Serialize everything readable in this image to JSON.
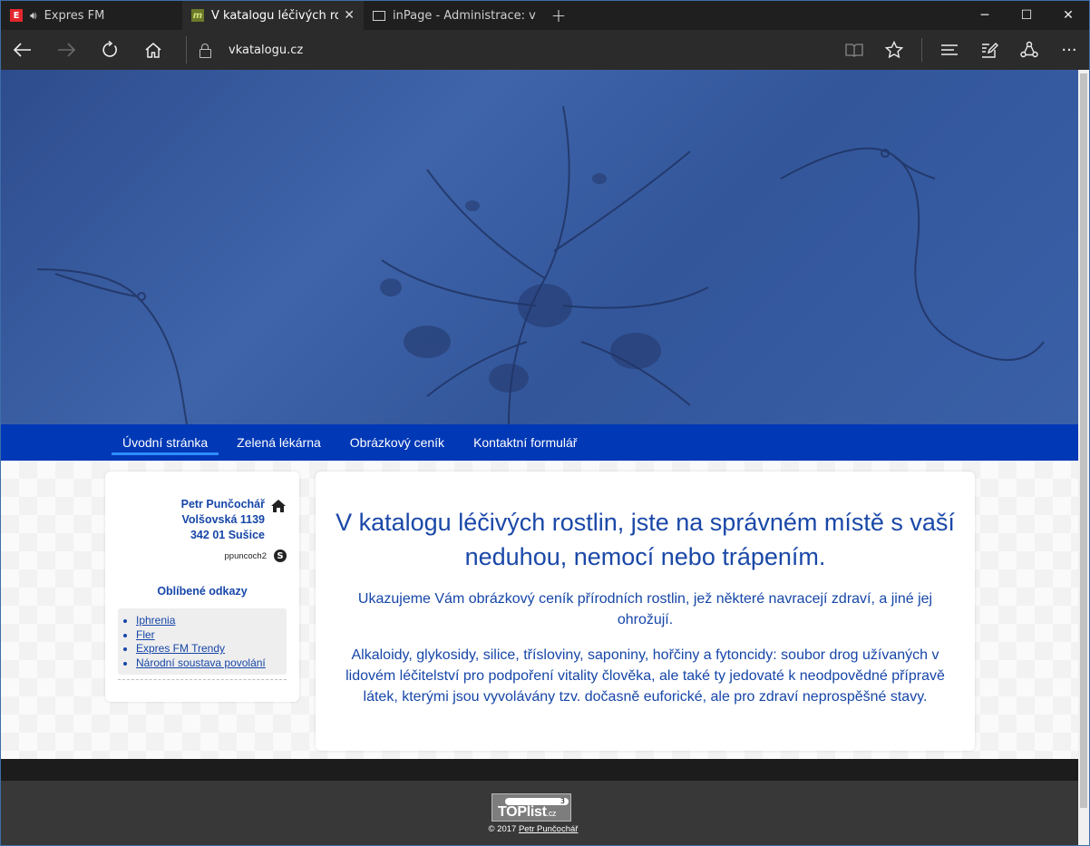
{
  "browser": {
    "tabs": [
      {
        "label": "Expres FM",
        "favicon": "E"
      },
      {
        "label": "V katalogu léčivých rost",
        "favicon": "m"
      },
      {
        "label": "inPage - Administrace: vkat",
        "favicon": ""
      }
    ],
    "url": "vkatalogu.cz"
  },
  "menu": {
    "items": [
      "Úvodní stránka",
      "Zelená lékárna",
      "Obrázkový ceník",
      "Kontaktní formulář"
    ]
  },
  "sidebar": {
    "name": "Petr Punčochář",
    "street": "Volšovská 1139",
    "city": "342 01 Sušice",
    "skype": "ppuncoch2",
    "favorites_title": "Oblíbené odkazy",
    "links": [
      "Iphrenia",
      "Fler",
      "Expres FM Trendy",
      "Národní soustava povolání"
    ]
  },
  "main": {
    "heading": "V katalogu léčivých rostlin, jste na správném místě s vaší neduhou, nemocí nebo trápením.",
    "paragraph1": "Ukazujeme Vám obrázkový ceník přírodních rostlin, jež některé navracejí zdraví, a jiné jej ohrožují.",
    "paragraph2": "Alkaloidy, glykosidy, silice, třísloviny, saponiny, hořčiny a fytoncidy: soubor drog užívaných v lidovém léčitelství pro podpoření vitality člověka, ale také ty jedovaté k neodpovědné přípravě látek, kterými jsou vyvolávány tzv. dočasně euforické, ale pro zdraví neprospěšné stavy."
  },
  "footer": {
    "toplist_count": "3",
    "toplist_brand": "TOPlist",
    "toplist_tld": ".cz",
    "copyright": "© 2017",
    "author": "Petr Punčochář"
  },
  "colors": {
    "menu_bg": "#0038b6",
    "text_blue": "#1646a8",
    "accent": "#2f8cff"
  }
}
